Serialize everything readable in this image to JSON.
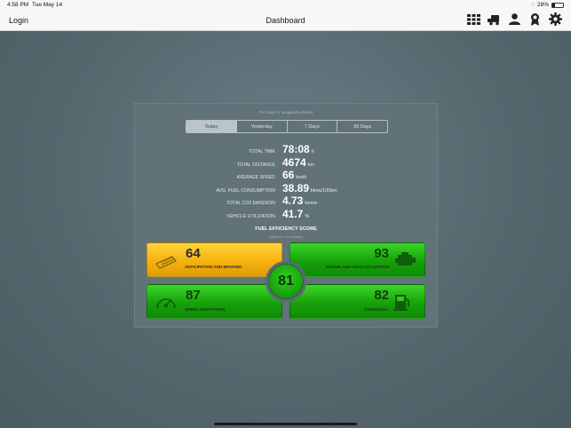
{
  "status_bar": {
    "time": "4:58 PM",
    "date": "Tue May 14",
    "battery": "28%"
  },
  "nav": {
    "left_label": "Login",
    "title": "Dashboard"
  },
  "card": {
    "subtitle": "For have 17 assigned vehicles",
    "tabs": [
      "Today",
      "Yesterday",
      "7 Days",
      "30 Days"
    ],
    "active_tab": "Today",
    "metrics": [
      {
        "label": "TOTAL TIME",
        "value": "78:08",
        "unit": "h"
      },
      {
        "label": "TOTAL DISTANCE",
        "value": "4674",
        "unit": "km"
      },
      {
        "label": "AVERAGE SPEED",
        "value": "66",
        "unit": "km/h"
      },
      {
        "label": "AVG. FUEL CONSUMPTION",
        "value": "38.89",
        "unit": "litres/100km"
      },
      {
        "label": "TOTAL CO2 EMISSION",
        "value": "4.73",
        "unit": "tonne"
      },
      {
        "label": "VEHICLE UTILIZATION",
        "value": "41.7",
        "unit": "%"
      }
    ],
    "fuel_efficiency": {
      "title": "FUEL EFFICIENCY SCORE",
      "subtitle": "based on 12 vehicles",
      "overall": "81",
      "tiles": {
        "anticipation": {
          "score": "64",
          "label": "ANTICIPATION AND BRAKING"
        },
        "engine_gear": {
          "score": "93",
          "label": "ENGINE AND GEAR UTILIZATION"
        },
        "speed": {
          "score": "87",
          "label": "SPEED ADAPTATION"
        },
        "standstill": {
          "score": "82",
          "label": "STANDSTILL"
        }
      }
    }
  }
}
